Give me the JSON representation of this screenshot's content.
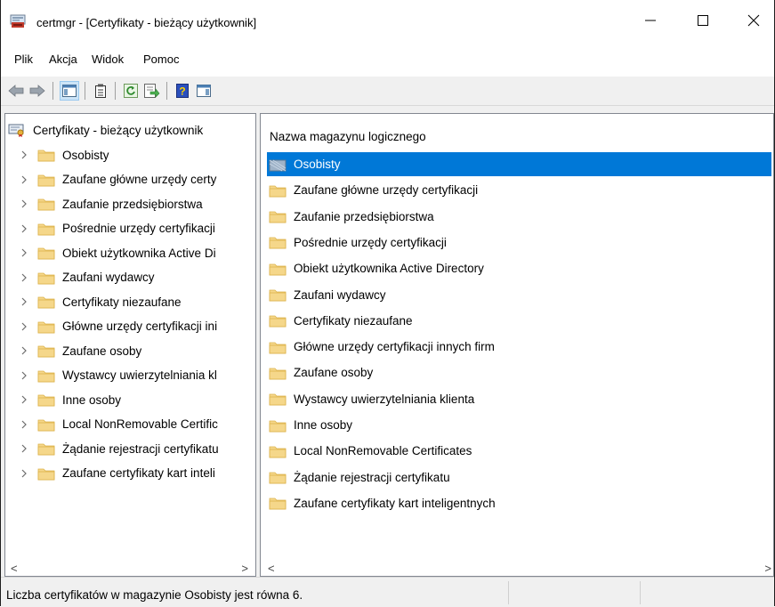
{
  "window": {
    "title": "certmgr - [Certyfikaty - bieżący użytkownik]",
    "controls": {
      "minimize": "—",
      "maximize": "☐",
      "close": "✕"
    }
  },
  "menu": [
    "Plik",
    "Akcja",
    "Widok",
    "Pomoc"
  ],
  "toolbar": {
    "icons": [
      "back-icon",
      "forward-icon",
      "show-hide-tree-icon",
      "properties-icon",
      "refresh-icon",
      "export-list-icon",
      "help-icon",
      "show-hide-action-pane-icon"
    ]
  },
  "tree": {
    "root": "Certyfikaty - bieżący użytkownik",
    "items": [
      "Osobisty",
      "Zaufane główne urzędy certy",
      "Zaufanie przedsiębiorstwa",
      "Pośrednie urzędy certyfikacji",
      "Obiekt użytkownika Active Di",
      "Zaufani wydawcy",
      "Certyfikaty niezaufane",
      "Główne urzędy certyfikacji ini",
      "Zaufane osoby",
      "Wystawcy uwierzytelniania kl",
      "Inne osoby",
      "Local NonRemovable Certific",
      "Żądanie rejestracji certyfikatu",
      "Zaufane certyfikaty kart inteli"
    ]
  },
  "list": {
    "column_header": "Nazwa magazynu logicznego",
    "selected_index": 0,
    "items": [
      "Osobisty",
      "Zaufane główne urzędy certyfikacji",
      "Zaufanie przedsiębiorstwa",
      "Pośrednie urzędy certyfikacji",
      "Obiekt użytkownika Active Directory",
      "Zaufani wydawcy",
      "Certyfikaty niezaufane",
      "Główne urzędy certyfikacji innych firm",
      "Zaufane osoby",
      "Wystawcy uwierzytelniania klienta",
      "Inne osoby",
      "Local NonRemovable Certificates",
      "Żądanie rejestracji certyfikatu",
      "Zaufane certyfikaty kart inteligentnych"
    ]
  },
  "status": {
    "text": "Liczba certyfikatów w magazynie Osobisty jest równa 6."
  },
  "colors": {
    "selection": "#0078d7",
    "folder": "#f5d78a",
    "folder_dark": "#dcb24a"
  }
}
